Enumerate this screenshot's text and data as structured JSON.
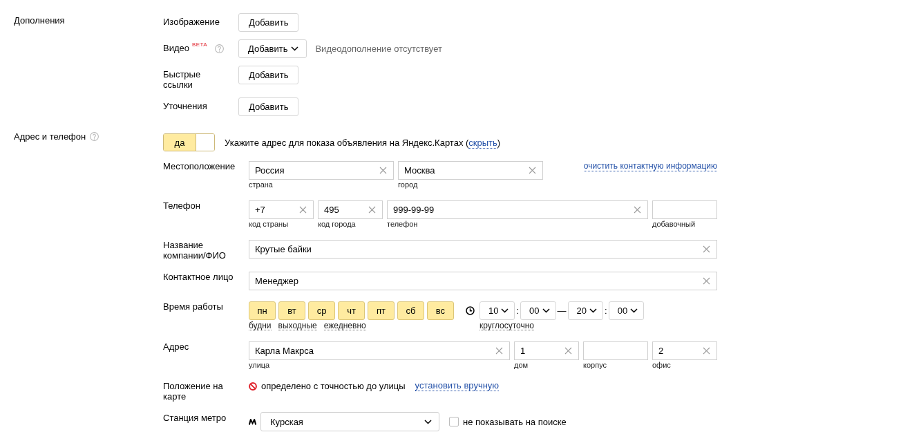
{
  "addons": {
    "label": "Дополнения",
    "rows": [
      {
        "label": "Изображение",
        "help": false,
        "button": "Добавить",
        "dropdown": false
      },
      {
        "label": "Видео",
        "badge": "BETA",
        "help": true,
        "button": "Добавить",
        "dropdown": true,
        "note": "Видеодополнение отсутствует"
      },
      {
        "label": "Быстрые ссылки",
        "help": false,
        "button": "Добавить",
        "dropdown": false
      },
      {
        "label": "Уточнения",
        "help": false,
        "button": "Добавить",
        "dropdown": false
      }
    ]
  },
  "contacts": {
    "label": "Адрес и телефон",
    "help": true,
    "toggle": {
      "label": "да",
      "on": true
    },
    "hint": [
      {
        "kind": "text",
        "text": "Укажите адрес для показа объявления на Яндекс.Картах ("
      },
      {
        "kind": "link",
        "text": "скрыть"
      },
      {
        "kind": "text",
        "text": ")"
      }
    ],
    "rows": [
      {
        "kind": "location",
        "label": "Местоположение",
        "fields": [
          {
            "value": "Россия",
            "caption": "страна"
          },
          {
            "value": "Москва",
            "caption": "город"
          }
        ],
        "link": "очистить контактную информацию"
      },
      {
        "kind": "phone",
        "label": "Телефон",
        "fields": [
          {
            "value": "+7",
            "caption": "код страны"
          },
          {
            "value": "495",
            "caption": "код города"
          },
          {
            "value": "999-99-99",
            "caption": "телефон"
          },
          {
            "caption": "добавочный"
          }
        ]
      },
      {
        "kind": "text",
        "label": "Название компании/ФИО",
        "value": "Крутые байки"
      },
      {
        "kind": "text",
        "label": "Контактное лицо",
        "value": "Менеджер"
      },
      {
        "kind": "hours",
        "label": "Время работы",
        "days": [
          {
            "label": "пн",
            "selected": true
          },
          {
            "label": "вт",
            "selected": true
          },
          {
            "label": "ср",
            "selected": true
          },
          {
            "label": "чт",
            "selected": true
          },
          {
            "label": "пт",
            "selected": true
          },
          {
            "label": "сб",
            "selected": true
          },
          {
            "label": "вс",
            "selected": true
          }
        ],
        "presets": [
          "будни",
          "выходные",
          "ежедневно"
        ],
        "time": [
          {
            "kind": "select",
            "text": "10"
          },
          {
            "kind": "separator",
            "text": ":"
          },
          {
            "kind": "select",
            "text": "00"
          },
          {
            "kind": "separator",
            "text": "—"
          },
          {
            "kind": "select",
            "text": "20"
          },
          {
            "kind": "separator",
            "text": ":"
          },
          {
            "kind": "select",
            "text": "00"
          }
        ],
        "all_day": "круглосуточно"
      },
      {
        "kind": "address",
        "label": "Адрес",
        "fields": [
          {
            "value": "Карла Макрса",
            "caption": "улица"
          },
          {
            "value": "1",
            "caption": "дом"
          },
          {
            "caption": "корпус"
          },
          {
            "value": "2",
            "caption": "офис"
          }
        ]
      },
      {
        "kind": "map",
        "label": "Положение на карте",
        "status": "определено с точностью до улицы",
        "link": "установить вручную"
      },
      {
        "kind": "metro",
        "label": "Станция метро",
        "value": "Курская",
        "checkbox": {
          "label": "не показывать на поиске",
          "checked": false
        }
      }
    ]
  }
}
